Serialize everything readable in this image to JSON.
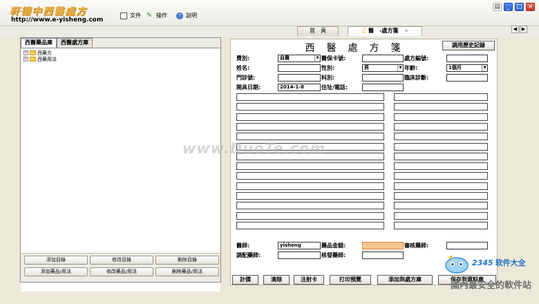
{
  "app": {
    "logo_text": "軒德中西醫處方",
    "url": "http://www.e-yisheng.com"
  },
  "menu": {
    "file": "文件",
    "operate": "操作",
    "help": "說明"
  },
  "tabs": {
    "home": "首　頁",
    "prescription": "醫　-處方箋",
    "close": "×"
  },
  "left": {
    "tab_drugs": "西醫藥品庫",
    "tab_rx": "西醫處方庫",
    "tree": [
      {
        "label": "西藥方"
      },
      {
        "label": "西藥用法"
      }
    ],
    "buttons": {
      "add_dir": "添加目錄",
      "edit_dir": "修改目錄",
      "del_dir": "刪除目錄",
      "add_drug": "添加藥品/用法",
      "edit_drug": "修改藥品/用法",
      "del_drug": "刪除藥品/用法"
    }
  },
  "form": {
    "title": "西醫處方箋",
    "history_button": "調用歷史記錄",
    "fee_label": "費別:",
    "fee_value": "自費",
    "insurance_label": "醫保卡號:",
    "rx_no_label": "處方編號:",
    "name_label": "姓名:",
    "sex_label": "性別:",
    "sex_value": "男",
    "age_label": "年齡:",
    "age_value": "1個月",
    "clinic_label": "門診號:",
    "dept_label": "科別:",
    "diag_label": "臨床診斷:",
    "date_label": "開具日期:",
    "date_value": "2014-1-8",
    "address_label": "住址/電話:",
    "doctor_label": "醫師:",
    "doctor_value": "yisheng",
    "amount_label": "藥品金額:",
    "reviewer_label": "審核藥師:",
    "dispenser_label": "調配藥師:",
    "checker_label": "核發藥師:"
  },
  "bottom_buttons": {
    "calc": "計價",
    "clear": "清除",
    "injection": "注射卡",
    "print_preview": "打印預覽",
    "add_to_rx": "添加到處方庫",
    "save_to_db": "保存到資料庫"
  },
  "overlay": {
    "watermark": "www.DuoTe.com",
    "brand_num": "2345",
    "brand_text": "软件大全",
    "brand_sub": "國內最安全的軟件站"
  }
}
